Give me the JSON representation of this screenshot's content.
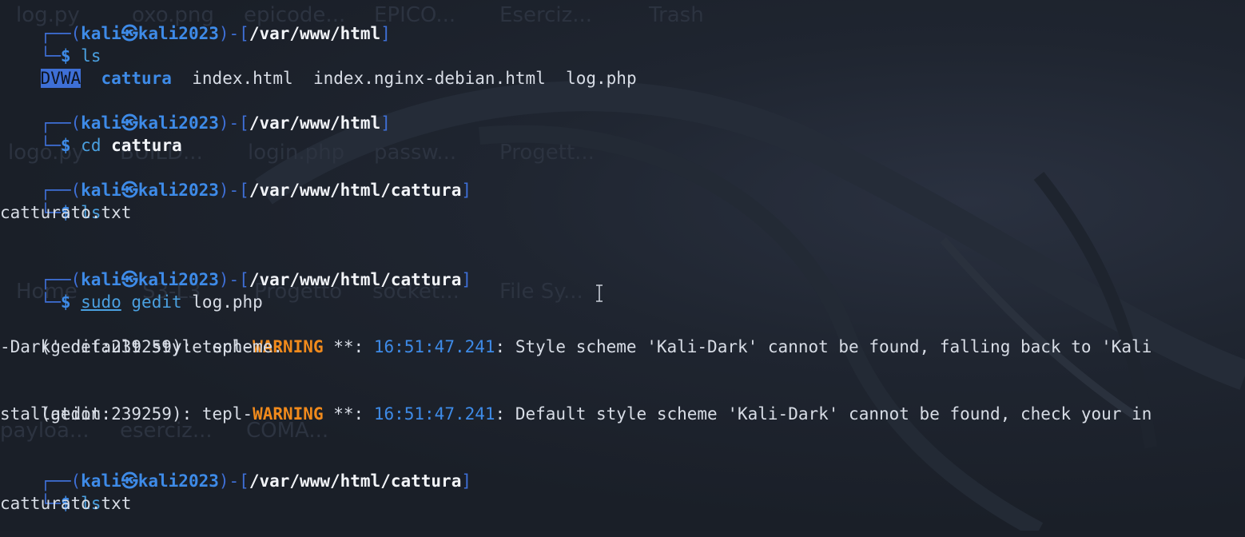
{
  "theme": {
    "background": "#1b2029",
    "prompt_blue": "#3e8be8",
    "frame_blue": "#3e6fd6",
    "warning_orange": "#f08a1c",
    "text": "#d8dde6"
  },
  "background_labels": {
    "row1": [
      "log.py",
      "oxo.png",
      "epicode...",
      "EPICO...",
      "Eserciz...",
      "Trash"
    ],
    "row2": [
      "logo.py",
      "BUILD...",
      "login.php",
      "passw...",
      "Progett..."
    ],
    "row3": [
      "Home",
      "S3-L3",
      "Progetto",
      "socket...",
      "File Sy..."
    ],
    "row4": [
      "payloa...",
      "eserciz...",
      "COMA..."
    ]
  },
  "prompt": {
    "user": "kali",
    "separator_icon": "kali-dragon-icon",
    "host": "kali2023"
  },
  "blocks": [
    {
      "path": "/var/www/html",
      "command": "ls",
      "output": {
        "dir_highlight": "DVWA",
        "dir": "cattura",
        "files": [
          "index.html",
          "index.nginx-debian.html",
          "log.php"
        ]
      }
    },
    {
      "path": "/var/www/html",
      "command": "cd",
      "argument": "cattura"
    },
    {
      "path": "/var/www/html/cattura",
      "command": "ls",
      "output_line": "catturato.txt"
    },
    {
      "path": "/var/www/html/cattura",
      "command_sudo": "sudo",
      "command": "gedit",
      "argument": "log.php",
      "warnings": [
        {
          "prefix": "(gedit:239259): tepl-",
          "level": "WARNING",
          "stars": " **: ",
          "time": "16:51:47.241",
          "message_line1": ": Style scheme 'Kali-Dark' cannot be found, falling back to 'Kali",
          "message_line2": "-Dark' default style scheme."
        },
        {
          "prefix": "(gedit:239259): tepl-",
          "level": "WARNING",
          "stars": " **: ",
          "time": "16:51:47.241",
          "message_line1": ": Default style scheme 'Kali-Dark' cannot be found, check your in",
          "message_line2": "stallation."
        }
      ]
    },
    {
      "path": "/var/www/html/cattura",
      "command": "ls",
      "output_line": "catturato.txt"
    }
  ]
}
